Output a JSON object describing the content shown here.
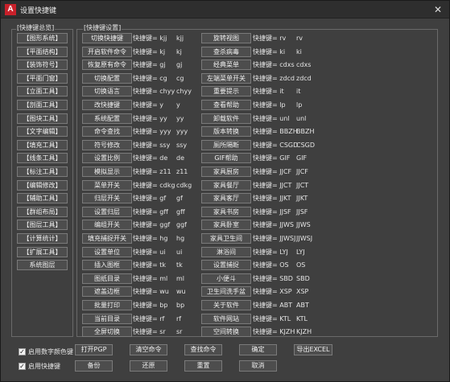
{
  "window": {
    "title": "设置快捷键",
    "app_icon_letter": "A",
    "close_icon": "close-icon"
  },
  "overview_label": "[快捷键总览]",
  "settings_label": "[快捷键设置]",
  "categories": [
    "【图形系统】",
    "【平面结构】",
    "【装饰符号】",
    "【平面门窗】",
    "【立面工具】",
    "【剖面工具】",
    "【图块工具】",
    "【文字编辑】",
    "【填充工具】",
    "【线条工具】",
    "【标注工具】",
    "【编辑修改】",
    "【辅助工具】",
    "【群组布局】",
    "【图层工具】",
    "【计算统计】",
    "【扩展工具】",
    "系统图层"
  ],
  "commands_left": [
    {
      "name": "切换快捷键",
      "key": "快捷键= kjj",
      "value": "kjj"
    },
    {
      "name": "开启软件命令",
      "key": "快捷键= kj",
      "value": "kj"
    },
    {
      "name": "恢复原有命令",
      "key": "快捷键= gj",
      "value": "gj"
    },
    {
      "name": "切换配置",
      "key": "快捷键= cg",
      "value": "cg"
    },
    {
      "name": "切换语言",
      "key": "快捷键= chyy",
      "value": "chyy"
    },
    {
      "name": "改快捷键",
      "key": "快捷键= y",
      "value": "y"
    },
    {
      "name": "系统配置",
      "key": "快捷键= yy",
      "value": "yy"
    },
    {
      "name": "命令查找",
      "key": "快捷键= yyy",
      "value": "yyy"
    },
    {
      "name": "符号修改",
      "key": "快捷键= ssy",
      "value": "ssy"
    },
    {
      "name": "设置比例",
      "key": "快捷键= de",
      "value": "de"
    },
    {
      "name": "模拟显示",
      "key": "快捷键= z11",
      "value": "z11"
    },
    {
      "name": "菜单开关",
      "key": "快捷键= cdkg",
      "value": "cdkg"
    },
    {
      "name": "归层开关",
      "key": "快捷键= gf",
      "value": "gf"
    },
    {
      "name": "设置归层",
      "key": "快捷键= gff",
      "value": "gff"
    },
    {
      "name": "编组开关",
      "key": "快捷键= ggf",
      "value": "ggf"
    },
    {
      "name": "填充捕捉开关",
      "key": "快捷键= hg",
      "value": "hg"
    },
    {
      "name": "设置单位",
      "key": "快捷键= ui",
      "value": "ui"
    },
    {
      "name": "插入图框",
      "key": "快捷键= tk",
      "value": "tk"
    },
    {
      "name": "图纸目录",
      "key": "快捷键= ml",
      "value": "ml"
    },
    {
      "name": "遮盖边框",
      "key": "快捷键= wu",
      "value": "wu"
    },
    {
      "name": "批量打印",
      "key": "快捷键= bp",
      "value": "bp"
    },
    {
      "name": "当前目录",
      "key": "快捷键= rf",
      "value": "rf"
    },
    {
      "name": "全屏切换",
      "key": "快捷键= sr",
      "value": "sr"
    }
  ],
  "commands_right": [
    {
      "name": "旋转视图",
      "key": "快捷键= rv",
      "value": "rv"
    },
    {
      "name": "查杀病毒",
      "key": "快捷键= ki",
      "value": "ki"
    },
    {
      "name": "经典菜单",
      "key": "快捷键= cdxs",
      "value": "cdxs"
    },
    {
      "name": "左端菜单开关",
      "key": "快捷键= zdcd",
      "value": "zdcd"
    },
    {
      "name": "重要提示",
      "key": "快捷键= it",
      "value": "it"
    },
    {
      "name": "查看帮助",
      "key": "快捷键= lp",
      "value": "lp"
    },
    {
      "name": "卸载软件",
      "key": "快捷键= unl",
      "value": "unl"
    },
    {
      "name": "版本转换",
      "key": "快捷键= BBZH",
      "value": "BBZH"
    },
    {
      "name": "厕所隔断",
      "key": "快捷键= CSGD",
      "value": "CSGD"
    },
    {
      "name": "GIF帮助",
      "key": "快捷键= GIF",
      "value": "GIF"
    },
    {
      "name": "家具厨房",
      "key": "快捷键= JJCF",
      "value": "JJCF"
    },
    {
      "name": "家具餐厅",
      "key": "快捷键= JJCT",
      "value": "JJCT"
    },
    {
      "name": "家具客厅",
      "key": "快捷键= JJKT",
      "value": "JJKT"
    },
    {
      "name": "家具书房",
      "key": "快捷键= JJSF",
      "value": "JJSF"
    },
    {
      "name": "家具卧室",
      "key": "快捷键= JJWS",
      "value": "JJWS"
    },
    {
      "name": "家具卫生间",
      "key": "快捷键= JJWSJ",
      "value": "JJWSJ"
    },
    {
      "name": "淋浴间",
      "key": "快捷键= LYJ",
      "value": "LYJ"
    },
    {
      "name": "设置捕捉",
      "key": "快捷键= OS",
      "value": "OS"
    },
    {
      "name": "小便斗",
      "key": "快捷键= SBD",
      "value": "SBD"
    },
    {
      "name": "卫生间洗手盆",
      "key": "快捷键= XSP",
      "value": "XSP"
    },
    {
      "name": "关于软件",
      "key": "快捷键= ABT",
      "value": "ABT"
    },
    {
      "name": "软件网站",
      "key": "快捷键= KTL",
      "value": "KTL"
    },
    {
      "name": "空间转换",
      "key": "快捷键= KJZH",
      "value": "KJZH"
    }
  ],
  "checkboxes": [
    {
      "label": "启用数字颜色键",
      "checked": "✓"
    },
    {
      "label": "启用快捷键",
      "checked": "✓"
    }
  ],
  "bottom_row1": [
    "打开PGP",
    "清空命令",
    "查找命令",
    "确定",
    "导出EXCEL"
  ],
  "bottom_row2": [
    "备份",
    "还原",
    "重置",
    "取消"
  ]
}
